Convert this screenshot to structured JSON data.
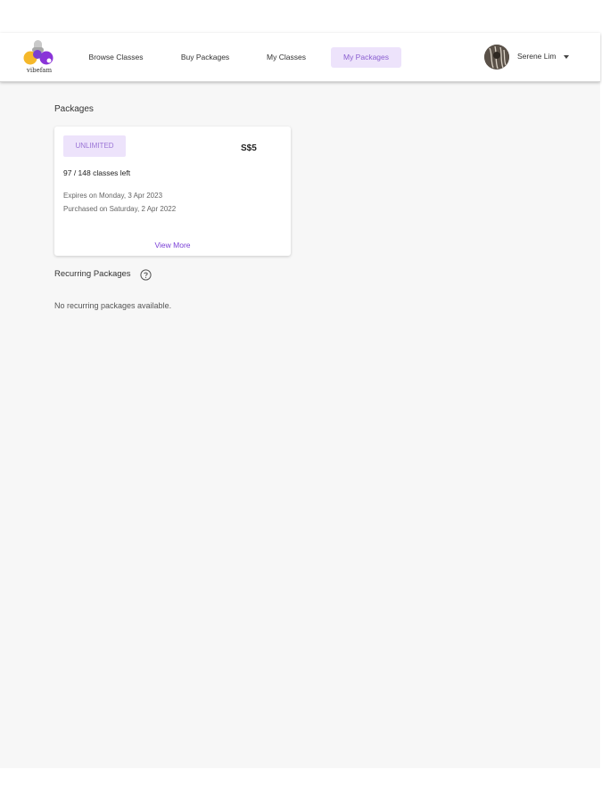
{
  "brand": {
    "logo_text": "vibefam"
  },
  "nav": {
    "items": [
      {
        "label": "Browse Classes",
        "active": false
      },
      {
        "label": "Buy Packages",
        "active": false
      },
      {
        "label": "My Classes",
        "active": false
      },
      {
        "label": "My Packages",
        "active": true
      }
    ]
  },
  "user": {
    "name": "Serene Lim"
  },
  "packages": {
    "title": "Packages",
    "cards": [
      {
        "badge": "UNLIMITED",
        "price": "S$5",
        "classes_left": "97 / 148 classes left",
        "expires": "Expires on Monday, 3 Apr 2023",
        "purchased": "Purchased on Saturday, 2 Apr 2022",
        "view_more": "View More"
      }
    ]
  },
  "recurring": {
    "title": "Recurring Packages",
    "empty_text": "No recurring packages available."
  },
  "icons": {
    "help": "question-circle-icon",
    "caret": "caret-down-icon",
    "logo": "vibefam-logo"
  },
  "colors": {
    "accent": "#7a3fd6",
    "accent_light": "#ede3fb",
    "background": "#f7f7f7"
  }
}
